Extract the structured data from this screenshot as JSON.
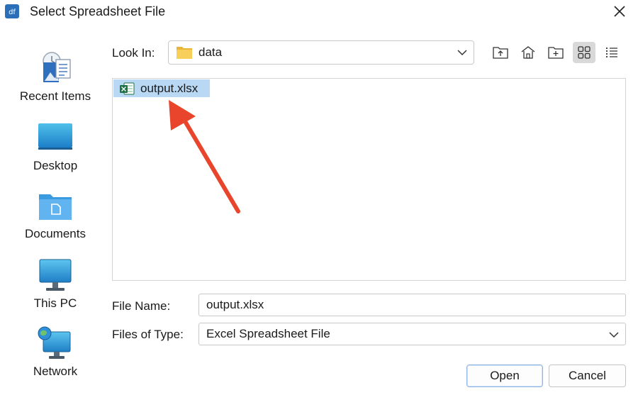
{
  "window": {
    "title": "Select Spreadsheet File",
    "app_icon": "app-logo-icon",
    "close_icon": "close-icon"
  },
  "sidebar": {
    "items": [
      {
        "label": "Recent Items",
        "icon": "recent-items-icon"
      },
      {
        "label": "Desktop",
        "icon": "desktop-icon"
      },
      {
        "label": "Documents",
        "icon": "documents-folder-icon"
      },
      {
        "label": "This PC",
        "icon": "computer-icon"
      },
      {
        "label": "Network",
        "icon": "network-icon"
      }
    ]
  },
  "lookin": {
    "label": "Look In:",
    "value": "data"
  },
  "toolbar": {
    "buttons": [
      {
        "icon": "up-folder-icon"
      },
      {
        "icon": "home-icon"
      },
      {
        "icon": "new-folder-icon"
      },
      {
        "icon": "grid-view-icon",
        "active": true
      },
      {
        "icon": "list-view-icon"
      }
    ]
  },
  "files": [
    {
      "name": "output.xlsx",
      "icon": "excel-file-icon",
      "selected": true
    }
  ],
  "form": {
    "file_name_label": "File Name:",
    "file_name_value": "output.xlsx",
    "file_type_label": "Files of Type:",
    "file_type_value": "Excel Spreadsheet File"
  },
  "buttons": {
    "open": "Open",
    "cancel": "Cancel"
  },
  "colors": {
    "selection": "#b9d8f4",
    "annotation_arrow": "#e8452c",
    "folder": "#f5c84c",
    "excel_green": "#1e7145"
  }
}
